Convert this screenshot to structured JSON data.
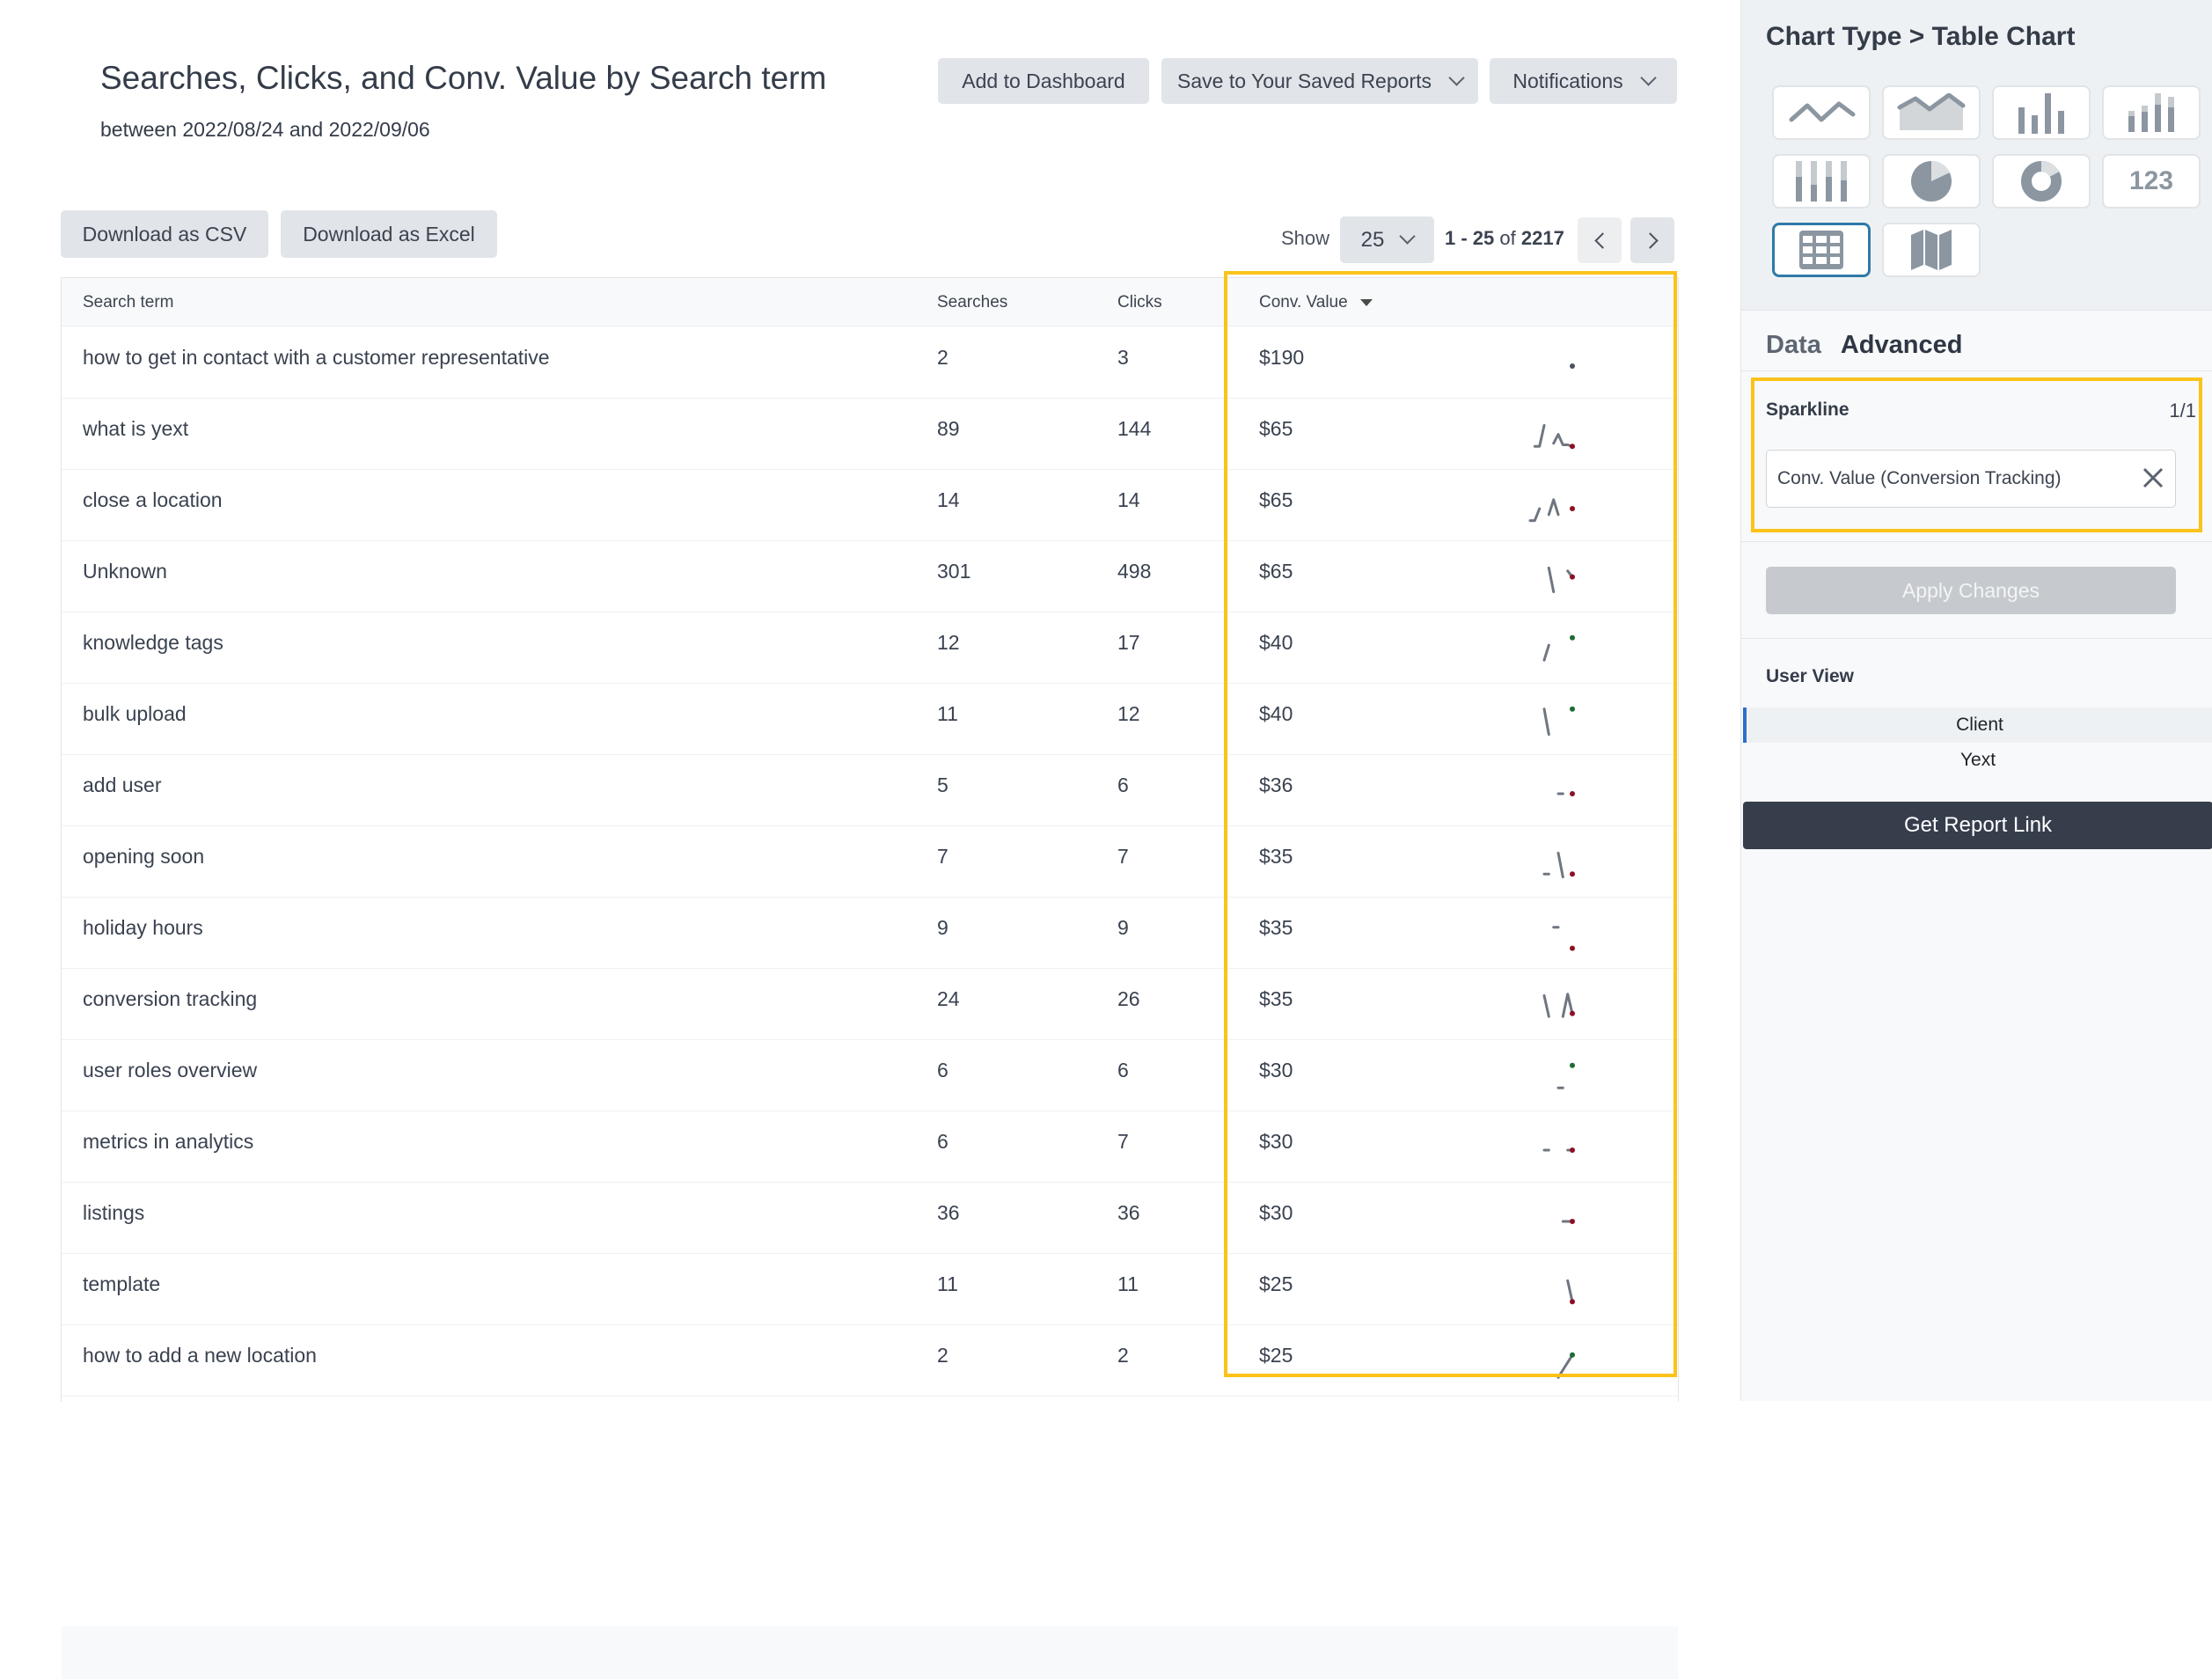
{
  "report": {
    "title": "Searches, Clicks, and Conv. Value by Search term",
    "subtitle": "between 2022/08/24 and 2022/09/06"
  },
  "toolbar": {
    "add_dashboard": "Add to Dashboard",
    "save_reports": "Save to Your Saved Reports",
    "notifications": "Notifications",
    "download_csv": "Download as CSV",
    "download_excel": "Download as Excel"
  },
  "pagination": {
    "show_label": "Show",
    "page_size": "25",
    "range": "1 - 25",
    "of": "of",
    "total": "2217"
  },
  "table": {
    "columns": [
      "Search term",
      "Searches",
      "Clicks",
      "Conv. Value"
    ],
    "sorted_column": "Conv. Value",
    "sort_direction": "descending",
    "rows": [
      {
        "term": "how to get in contact with a customer representative",
        "searches": "2",
        "clicks": "3",
        "conv_value": "$190",
        "spark": {
          "values": [
            null,
            null,
            null,
            null,
            null,
            0.5
          ],
          "trend": "neutral"
        }
      },
      {
        "term": "what is yext",
        "searches": "89",
        "clicks": "144",
        "conv_value": "$65",
        "spark": {
          "values": [
            0.2,
            0.2,
            0.9,
            null,
            0.3,
            0.6,
            0.25,
            0.25,
            0.2
          ],
          "trend": "down"
        }
      },
      {
        "term": "close a location",
        "searches": "14",
        "clicks": "14",
        "conv_value": "$65",
        "spark": {
          "values": [
            0.1,
            0.1,
            0.5,
            null,
            0.3,
            0.8,
            0.3,
            null,
            null,
            0.5
          ],
          "trend": "down"
        }
      },
      {
        "term": "Unknown",
        "searches": "301",
        "clicks": "498",
        "conv_value": "$65",
        "spark": {
          "values": [
            null,
            null,
            null,
            0.9,
            0.1,
            null,
            null,
            0.8,
            0.6
          ],
          "trend": "down"
        }
      },
      {
        "term": "knowledge tags",
        "searches": "12",
        "clicks": "17",
        "conv_value": "$40",
        "spark": {
          "values": [
            0.2,
            0.7,
            null,
            null,
            null,
            null,
            0.95
          ],
          "trend": "up"
        }
      },
      {
        "term": "bulk upload",
        "searches": "11",
        "clicks": "12",
        "conv_value": "$40",
        "spark": {
          "values": [
            0.95,
            0.1,
            null,
            null,
            null,
            null,
            0.95
          ],
          "trend": "up"
        }
      },
      {
        "term": "add user",
        "searches": "5",
        "clicks": "6",
        "conv_value": "$36",
        "spark": {
          "values": [
            null,
            null,
            null,
            0.5,
            0.5,
            null,
            0.5
          ],
          "trend": "down"
        }
      },
      {
        "term": "opening soon",
        "searches": "7",
        "clicks": "7",
        "conv_value": "$35",
        "spark": {
          "values": [
            0.2,
            0.2,
            null,
            0.9,
            0.1,
            null,
            0.2
          ],
          "trend": "down"
        }
      },
      {
        "term": "holiday hours",
        "searches": "9",
        "clicks": "9",
        "conv_value": "$35",
        "spark": {
          "values": [
            null,
            null,
            0.8,
            0.8,
            null,
            null,
            0.1
          ],
          "trend": "down"
        }
      },
      {
        "term": "conversion tracking",
        "searches": "24",
        "clicks": "26",
        "conv_value": "$35",
        "spark": {
          "values": [
            0.9,
            0.2,
            null,
            null,
            0.2,
            0.95,
            0.3
          ],
          "trend": "down"
        }
      },
      {
        "term": "user roles overview",
        "searches": "6",
        "clicks": "6",
        "conv_value": "$30",
        "spark": {
          "values": [
            null,
            null,
            null,
            0.2,
            0.2,
            null,
            0.95
          ],
          "trend": "up"
        }
      },
      {
        "term": "metrics in analytics",
        "searches": "6",
        "clicks": "7",
        "conv_value": "$30",
        "spark": {
          "values": [
            0.5,
            0.5,
            null,
            null,
            null,
            0.5,
            0.5
          ],
          "trend": "down"
        }
      },
      {
        "term": "listings",
        "searches": "36",
        "clicks": "36",
        "conv_value": "$30",
        "spark": {
          "values": [
            null,
            null,
            null,
            null,
            0.5,
            0.5,
            0.5
          ],
          "trend": "down"
        }
      },
      {
        "term": "template",
        "searches": "11",
        "clicks": "11",
        "conv_value": "$25",
        "spark": {
          "values": [
            null,
            null,
            null,
            null,
            null,
            0.9,
            0.2
          ],
          "trend": "down"
        }
      },
      {
        "term": "how to add a new location",
        "searches": "2",
        "clicks": "2",
        "conv_value": "$25",
        "spark": {
          "values": [
            0.05,
            0.3,
            0.55,
            0.8
          ],
          "trend": "up"
        }
      }
    ]
  },
  "colors": {
    "highlight": "#fbc31a",
    "spark_line": "#6f7680",
    "trend_up": "#1e6b35",
    "trend_down": "#8c1023",
    "trend_neutral": "#4b525c",
    "selected_tile": "#2f7aa8",
    "user_view_active": "#2d6fcb"
  },
  "sidebar": {
    "heading": "Chart Type > Table Chart",
    "chart_types": [
      {
        "name": "line-chart",
        "icon": "line-chart-icon",
        "selected": false
      },
      {
        "name": "area-chart",
        "icon": "area-chart-icon",
        "selected": false
      },
      {
        "name": "bar-chart",
        "icon": "bar-chart-icon",
        "selected": false
      },
      {
        "name": "stacked-bar-chart",
        "icon": "stacked-bar-chart-icon",
        "selected": false
      },
      {
        "name": "percent-bar-chart",
        "icon": "percent-bar-chart-icon",
        "selected": false
      },
      {
        "name": "pie-chart",
        "icon": "pie-chart-icon",
        "selected": false
      },
      {
        "name": "donut-chart",
        "icon": "donut-chart-icon",
        "selected": false
      },
      {
        "name": "number-chart",
        "icon": "number-icon",
        "label": "123",
        "selected": false
      },
      {
        "name": "table-chart",
        "icon": "table-icon",
        "selected": true
      },
      {
        "name": "map-chart",
        "icon": "map-icon",
        "selected": false
      }
    ],
    "tabs": {
      "data": "Data",
      "advanced": "Advanced",
      "active": "Advanced"
    },
    "sparkline": {
      "label": "Sparkline",
      "count": "1/1",
      "value": "Conv. Value (Conversion Tracking)"
    },
    "apply_label": "Apply Changes",
    "user_view": {
      "label": "User View",
      "options": [
        "Client",
        "Yext"
      ],
      "selected": "Client"
    },
    "report_link_label": "Get Report Link"
  }
}
